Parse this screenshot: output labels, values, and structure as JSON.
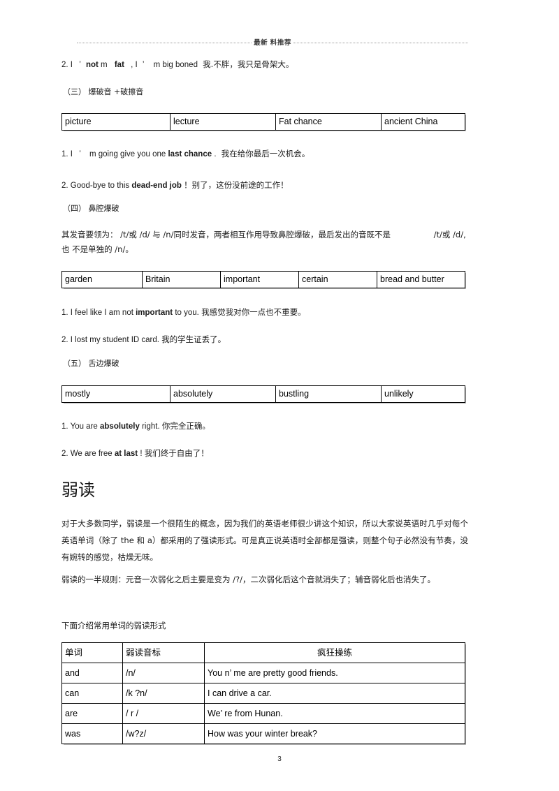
{
  "header": {
    "text": "最新 料推荐"
  },
  "blocks": {
    "sent_fat": {
      "num": "2. I",
      "ap1": "’",
      "bold1": "not",
      "mid1": "m",
      "bold2": "fat",
      "mid2": ", I",
      "ap2": "’",
      "tail_en": "m big boned",
      "tail_cn": "我.不胖，我只是骨架大。"
    },
    "sec3": "（三）  爆破音 +破擦音",
    "sec4": "（四）  鼻腔爆破",
    "sec5": "（五）  舌边爆破",
    "sent_last_chance": {
      "num": "1. I",
      "ap": "’",
      "mid": "m going give you one",
      "bold": "last chance",
      "tail_en": ".",
      "tail_cn": "我在给你最后一次机会。"
    },
    "sent_dead_end": {
      "lead": "2. Good-bye to this ",
      "bold": "dead-end job",
      "tail": "！别了，这份没前途的工作！"
    },
    "nasal_explain_1": "其发音要领为：   /t/或 /d/ 与 /n/同时发音，两者相互作用导致鼻腔爆破，最后发出的音既不是",
    "nasal_explain_1b": "/t/或 /d/,也",
    "nasal_explain_2": "不是单独的  /n/。",
    "sent_important": {
      "lead": "1. I feel like I am not ",
      "bold": "important",
      "tail_en": " to you.",
      "tail_cn": "  我感觉我对你一点也不重要。"
    },
    "sent_id_card": {
      "lead": "2. I lost my student ID card.",
      "tail_cn": "  我的学生证丢了。"
    },
    "sent_absolutely": {
      "lead": "1. You are ",
      "bold": "absolutely",
      "tail_en": " right.",
      "tail_cn": "  你完全正确。"
    },
    "sent_at_last": {
      "lead": "2. We are free ",
      "bold": "at last",
      "tail_en": "!",
      "tail_cn": " 我们终于自由了！"
    },
    "weak_heading": "弱读",
    "weak_para": "对于大多数同学，弱读是一个很陌生的概念，因为我们的英语老师很少讲这个知识，所以大家说英语时几乎对每个英语单词（除了 the 和 a）都采用的了强读形式。可是真正说英语时全部都是强读，则整个句子必然没有节奏，没有婉转的感觉，枯燥无味。",
    "weak_rule": "弱读的一半规则：元音一次弱化之后主要是变为 /?/，二次弱化后这个音就消失了；辅音弱化后也消失了。",
    "weak_intro": "下面介绍常用单词的弱读形式"
  },
  "tables": {
    "affricate": {
      "rows": [
        [
          "picture",
          "lecture",
          "Fat chance",
          "ancient China"
        ]
      ]
    },
    "nasal": {
      "rows": [
        [
          "garden",
          "Britain",
          "important",
          "certain",
          "bread and butter"
        ]
      ]
    },
    "lateral": {
      "rows": [
        [
          "mostly",
          "absolutely",
          "bustling",
          "unlikely"
        ]
      ]
    },
    "weak_forms": {
      "headers": [
        "单词",
        "弱读音标",
        "疯狂操练"
      ],
      "rows": [
        [
          "and",
          "/n/",
          "You n’ me are pretty good friends."
        ],
        [
          "can",
          "/k ?n/",
          "I can drive a car."
        ],
        [
          "are",
          "/ r /",
          "We’ re from Hunan."
        ],
        [
          "was",
          "/w?z/",
          "How was your winter break?"
        ]
      ]
    }
  },
  "footer": {
    "page_number": "3"
  }
}
